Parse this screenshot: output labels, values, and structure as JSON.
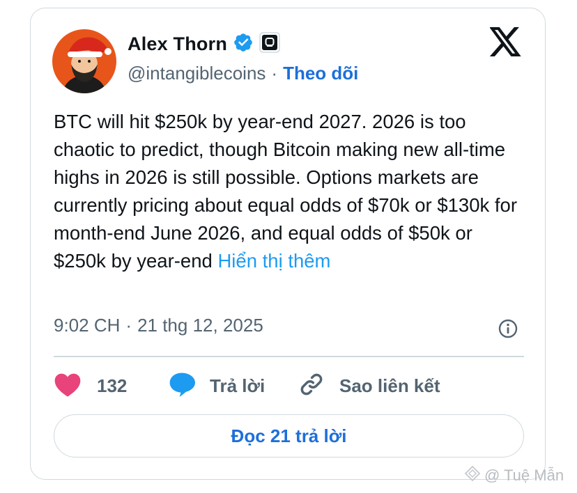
{
  "author": {
    "name": "Alex Thorn",
    "handle": "@intangiblecoins",
    "separator": "·",
    "follow_label": "Theo dõi"
  },
  "icons": {
    "verified": "verified-badge-icon",
    "affiliate": "affiliate-badge-icon",
    "platform": "x-logo-icon",
    "info": "info-icon",
    "like": "heart-icon",
    "reply": "speech-bubble-icon",
    "copy_link": "link-icon"
  },
  "tweet": {
    "text": "BTC will hit $250k by year-end 2027. 2026 is too chaotic to predict, though Bitcoin making new all-time highs in 2026 is still possible. Options markets are currently pricing about equal odds of $70k or $130k for month-end June 2026, and equal odds of $50k or $250k by year-end",
    "show_more": "Hiển thị thêm",
    "time": "9:02 CH",
    "date_separator": "·",
    "date": "21 thg 12, 2025"
  },
  "actions": {
    "like_count": "132",
    "reply_label": "Trả lời",
    "copy_link_label": "Sao liên kết"
  },
  "read_replies_label": "Đọc 21 trả lời",
  "watermark": "@ Tuệ Mẫn",
  "colors": {
    "link": "#1d9bf0",
    "follow": "#1d6fd9",
    "verified": "#1d9bf0",
    "heart": "#e8437a",
    "reply_bubble": "#1d9bf0",
    "muted": "#536471",
    "border": "#cfd9de"
  }
}
